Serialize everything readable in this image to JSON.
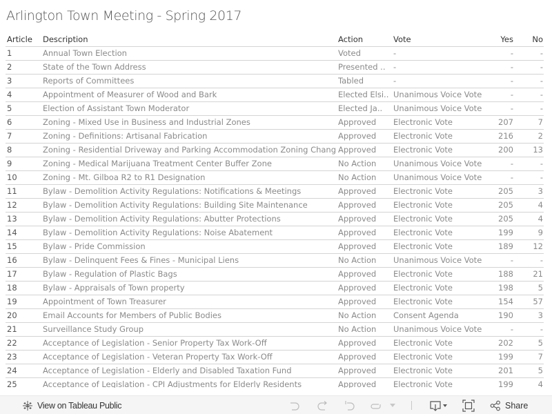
{
  "title": "Arlington Town Meeting - Spring 2017",
  "table": {
    "columns": {
      "article": "Article",
      "description": "Description",
      "action": "Action",
      "vote": "Vote",
      "yes": "Yes",
      "no": "No"
    },
    "rows": [
      {
        "article": "1",
        "description": "Annual Town Election",
        "action": "Voted",
        "vote": "-",
        "yes": "-",
        "no": "-"
      },
      {
        "article": "2",
        "description": "State of the Town Address",
        "action": "Presented ..",
        "vote": "-",
        "yes": "-",
        "no": "-"
      },
      {
        "article": "3",
        "description": "Reports of Committees",
        "action": "Tabled",
        "vote": "-",
        "yes": "-",
        "no": "-"
      },
      {
        "article": "4",
        "description": "Appointment of Measurer of Wood and Bark",
        "action": "Elected Elsi..",
        "vote": "Unanimous Voice Vote",
        "yes": "-",
        "no": "-"
      },
      {
        "article": "5",
        "description": "Election of Assistant Town Moderator",
        "action": "Elected Ja..",
        "vote": "Unanimous Voice Vote",
        "yes": "-",
        "no": "-"
      },
      {
        "article": "6",
        "description": "Zoning - Mixed Use in Business and Industrial Zones",
        "action": "Approved",
        "vote": "Electronic Vote",
        "yes": "207",
        "no": "7"
      },
      {
        "article": "7",
        "description": "Zoning - Definitions: Artisanal Fabrication",
        "action": "Approved",
        "vote": "Electronic Vote",
        "yes": "216",
        "no": "2"
      },
      {
        "article": "8",
        "description": "Zoning - Residential Driveway and Parking Accommodation Zoning Chang..",
        "action": "Approved",
        "vote": "Electronic Vote",
        "yes": "200",
        "no": "13"
      },
      {
        "article": "9",
        "description": "Zoning - Medical Marijuana Treatment Center Buffer Zone",
        "action": "No Action",
        "vote": "Unanimous Voice Vote",
        "yes": "-",
        "no": "-"
      },
      {
        "article": "10",
        "description": "Zoning - Mt. Gilboa R2 to R1 Designation",
        "action": "No Action",
        "vote": "Unanimous Voice Vote",
        "yes": "-",
        "no": "-"
      },
      {
        "article": "11",
        "description": "Bylaw - Demolition Activity Regulations: Notifications & Meetings",
        "action": "Approved",
        "vote": "Electronic Vote",
        "yes": "205",
        "no": "3"
      },
      {
        "article": "12",
        "description": "Bylaw - Demolition Activity Regulations: Building Site Maintenance",
        "action": "Approved",
        "vote": "Electronic Vote",
        "yes": "205",
        "no": "4"
      },
      {
        "article": "13",
        "description": "Bylaw - Demolition Activity Regulations: Abutter Protections",
        "action": "Approved",
        "vote": "Electronic Vote",
        "yes": "205",
        "no": "4"
      },
      {
        "article": "14",
        "description": "Bylaw - Demolition Activity Regulations: Noise Abatement",
        "action": "Approved",
        "vote": "Electronic Vote",
        "yes": "199",
        "no": "9"
      },
      {
        "article": "15",
        "description": "Bylaw - Pride Commission",
        "action": "Approved",
        "vote": "Electronic Vote",
        "yes": "189",
        "no": "12"
      },
      {
        "article": "16",
        "description": "Bylaw - Delinquent Fees & Fines - Municipal Liens",
        "action": "No Action",
        "vote": "Unanimous Voice Vote",
        "yes": "-",
        "no": "-"
      },
      {
        "article": "17",
        "description": "Bylaw - Regulation of Plastic Bags",
        "action": "Approved",
        "vote": "Electronic Vote",
        "yes": "188",
        "no": "21"
      },
      {
        "article": "18",
        "description": "Bylaw - Appraisals of Town property",
        "action": "Approved",
        "vote": "Electronic Vote",
        "yes": "198",
        "no": "5"
      },
      {
        "article": "19",
        "description": "Appointment of Town Treasurer",
        "action": "Approved",
        "vote": "Electronic Vote",
        "yes": "154",
        "no": "57"
      },
      {
        "article": "20",
        "description": "Email Accounts for Members of Public Bodies",
        "action": "No Action",
        "vote": "Consent Agenda",
        "yes": "190",
        "no": "3"
      },
      {
        "article": "21",
        "description": "Surveillance Study Group",
        "action": "No Action",
        "vote": "Unanimous Voice Vote",
        "yes": "-",
        "no": "-"
      },
      {
        "article": "22",
        "description": "Acceptance of Legislation - Senior Property Tax Work-Off",
        "action": "Approved",
        "vote": "Electronic Vote",
        "yes": "202",
        "no": "5"
      },
      {
        "article": "23",
        "description": "Acceptance of Legislation - Veteran Property Tax Work-Off",
        "action": "Approved",
        "vote": "Electronic Vote",
        "yes": "199",
        "no": "7"
      },
      {
        "article": "24",
        "description": "Acceptance of Legislation - Elderly and Disabled Taxation Fund",
        "action": "Approved",
        "vote": "Electronic Vote",
        "yes": "201",
        "no": "5"
      },
      {
        "article": "25",
        "description": "Acceptance of Legislation - CPI Adjustments for Elderly Residents",
        "action": "Approved",
        "vote": "Electronic Vote",
        "yes": "199",
        "no": "4"
      }
    ]
  },
  "toolbar": {
    "view_label": "View on Tableau Public",
    "share_label": "Share",
    "icons": {
      "view": "tableau-logo-icon",
      "undo": "undo-icon",
      "redo": "redo-icon",
      "revert": "revert-icon",
      "refresh": "refresh-icon",
      "download": "download-icon",
      "fullscreen": "fullscreen-icon",
      "share": "share-icon"
    }
  }
}
